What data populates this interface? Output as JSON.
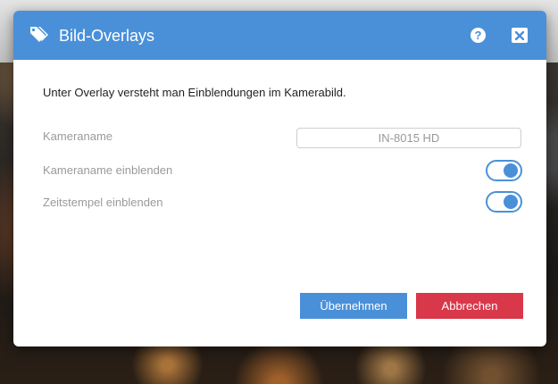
{
  "dialog": {
    "title": "Bild-Overlays",
    "header_icon": "tags-icon",
    "help_label": "?",
    "close_icon": "close-icon"
  },
  "content": {
    "intro": "Unter Overlay versteht man Einblendungen im Kamerabild.",
    "camera_name_label": "Kameraname",
    "camera_name_value": "IN-8015 HD",
    "show_camera_name_label": "Kameraname einblenden",
    "show_camera_name_enabled": true,
    "show_timestamp_label": "Zeitstempel einblenden",
    "show_timestamp_enabled": true
  },
  "buttons": {
    "apply": "Übernehmen",
    "cancel": "Abbrechen"
  },
  "colors": {
    "accent": "#4a90d9",
    "cancel": "#d9374a"
  }
}
